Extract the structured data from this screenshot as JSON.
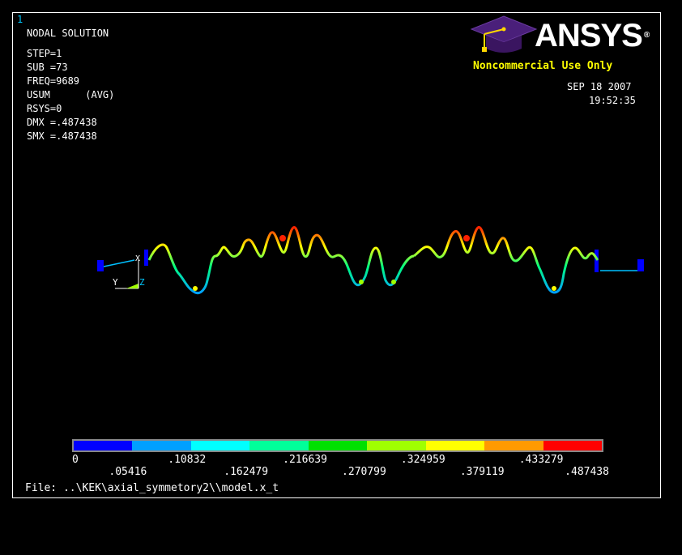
{
  "window_number": "1",
  "header": {
    "title": "NODAL SOLUTION",
    "lines": [
      "STEP=1",
      "SUB =73",
      "FREQ=9689",
      "USUM      (AVG)",
      "RSYS=0",
      "DMX =.487438",
      "SMX =.487438"
    ]
  },
  "logo": {
    "brand": "ANSYS",
    "registered": "®",
    "noncommercial": "Noncommercial Use Only"
  },
  "datetime": {
    "date": "SEP 18 2007",
    "time": "19:52:35"
  },
  "legend": {
    "colors": [
      "#0000ff",
      "#00a0ff",
      "#00ffff",
      "#00ff9a",
      "#00e000",
      "#a0ff00",
      "#ffff00",
      "#ff9a00",
      "#ff0000"
    ],
    "labels": [
      "0",
      ".05416",
      ".10832",
      ".162479",
      ".216639",
      ".270799",
      ".324959",
      ".379119",
      ".433279",
      ".487438"
    ]
  },
  "triad": {
    "y": "Y",
    "z": "Z",
    "x": "X"
  },
  "footer": {
    "file": "File: ..\\KEK\\axial_symmetory2\\\\model.x_t"
  }
}
